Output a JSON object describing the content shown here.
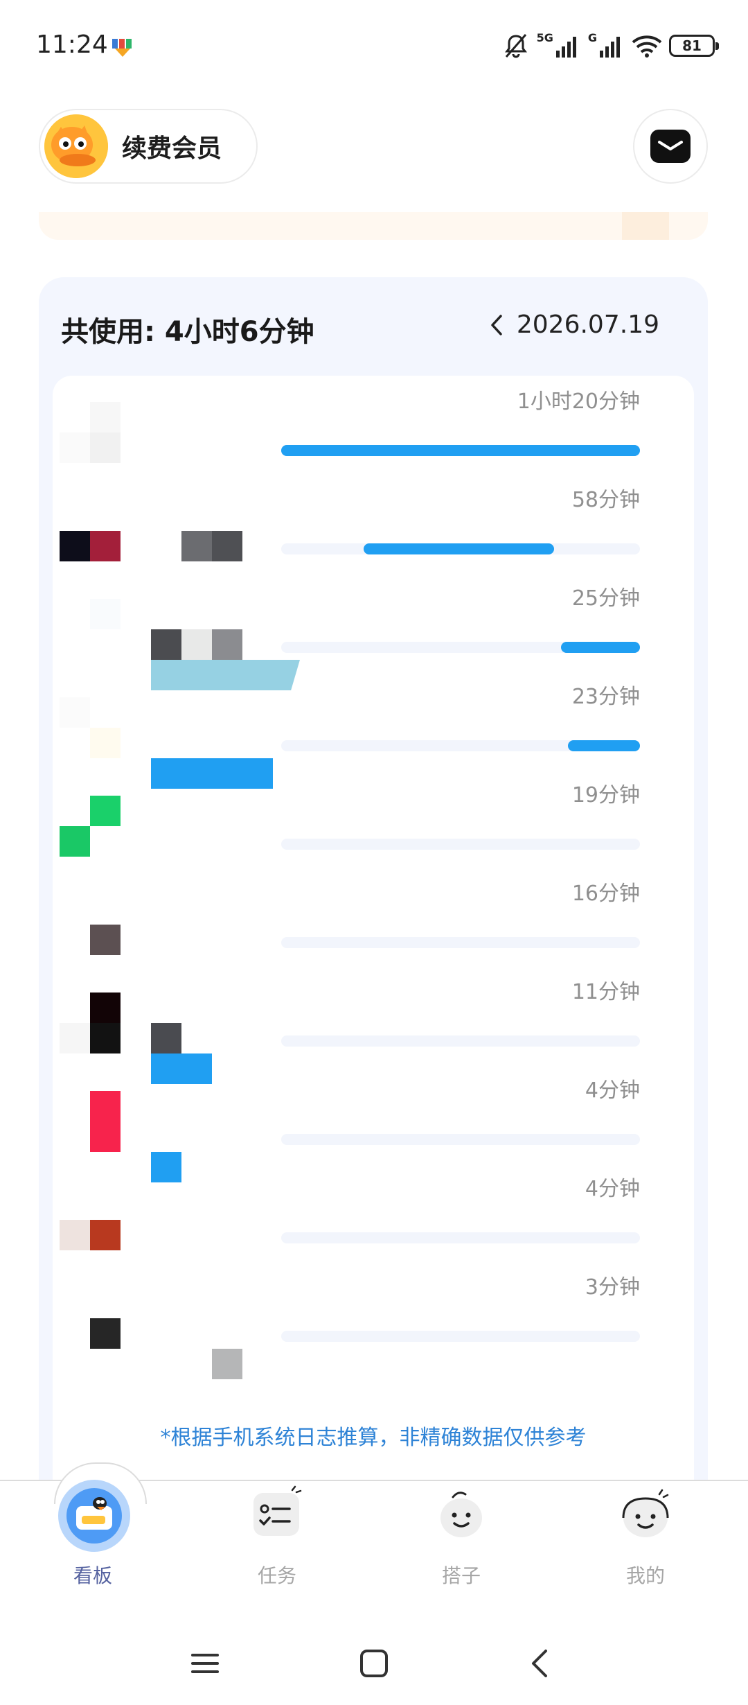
{
  "status_bar": {
    "time": "11:24",
    "signal_1_label": "5G",
    "signal_2_label": "G",
    "battery": "81",
    "icons": [
      "app-download-icon",
      "silent-bell-icon",
      "signal-icon",
      "wifi-icon",
      "battery-icon"
    ]
  },
  "header": {
    "member_label": "续费会员",
    "avatar_icon": "duck-avatar-icon",
    "mail_icon": "mail-icon"
  },
  "usage": {
    "total_label": "共使用: 4小时6分钟",
    "date": "2026.07.19",
    "prev_icon": "chevron-left-icon",
    "accent_color": "#209ff2",
    "rows": [
      {
        "duration": "1小时20分钟",
        "fraction": 1.0
      },
      {
        "duration": "58分钟",
        "fraction": 0.53
      },
      {
        "duration": "25分钟",
        "fraction": 0.22
      },
      {
        "duration": "23分钟",
        "fraction": 0.2
      },
      {
        "duration": "19分钟",
        "fraction": 0.0
      },
      {
        "duration": "16分钟",
        "fraction": 0.0
      },
      {
        "duration": "11分钟",
        "fraction": 0.0
      },
      {
        "duration": "4分钟",
        "fraction": 0.0
      },
      {
        "duration": "4分钟",
        "fraction": 0.0
      },
      {
        "duration": "3分钟",
        "fraction": 0.0
      }
    ],
    "footnote": "*根据手机系统日志推算，非精确数据仅供参考"
  },
  "tab_bar": {
    "tabs": [
      {
        "label": "看板",
        "icon": "dashboard-icon",
        "active": true
      },
      {
        "label": "任务",
        "icon": "task-list-icon",
        "active": false
      },
      {
        "label": "搭子",
        "icon": "buddy-face-icon",
        "active": false
      },
      {
        "label": "我的",
        "icon": "profile-face-icon",
        "active": false
      }
    ]
  },
  "system_nav": {
    "icons": [
      "menu-icon",
      "home-icon",
      "back-icon"
    ]
  }
}
